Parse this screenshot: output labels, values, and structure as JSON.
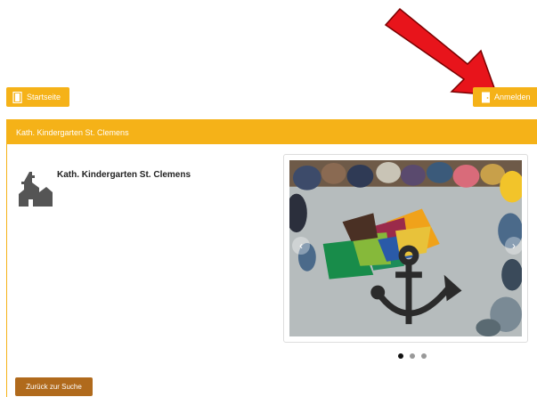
{
  "nav": {
    "home_label": "Startseite",
    "login_label": "Anmelden"
  },
  "panel": {
    "header_title": "Kath. Kindergarten St. Clemens",
    "kindergarten_name": "Kath. Kindergarten St. Clemens"
  },
  "carousel": {
    "prev_icon": "chevron-left-icon",
    "next_icon": "chevron-right-icon",
    "prev_glyph": "‹",
    "next_glyph": "›",
    "slide_count": 3,
    "active_slide": 1
  },
  "back_button_label": "Zurück zur Suche",
  "colors": {
    "accent": "#f5b218",
    "back_button": "#b06a1c",
    "annotation_arrow": "#e8141b"
  }
}
